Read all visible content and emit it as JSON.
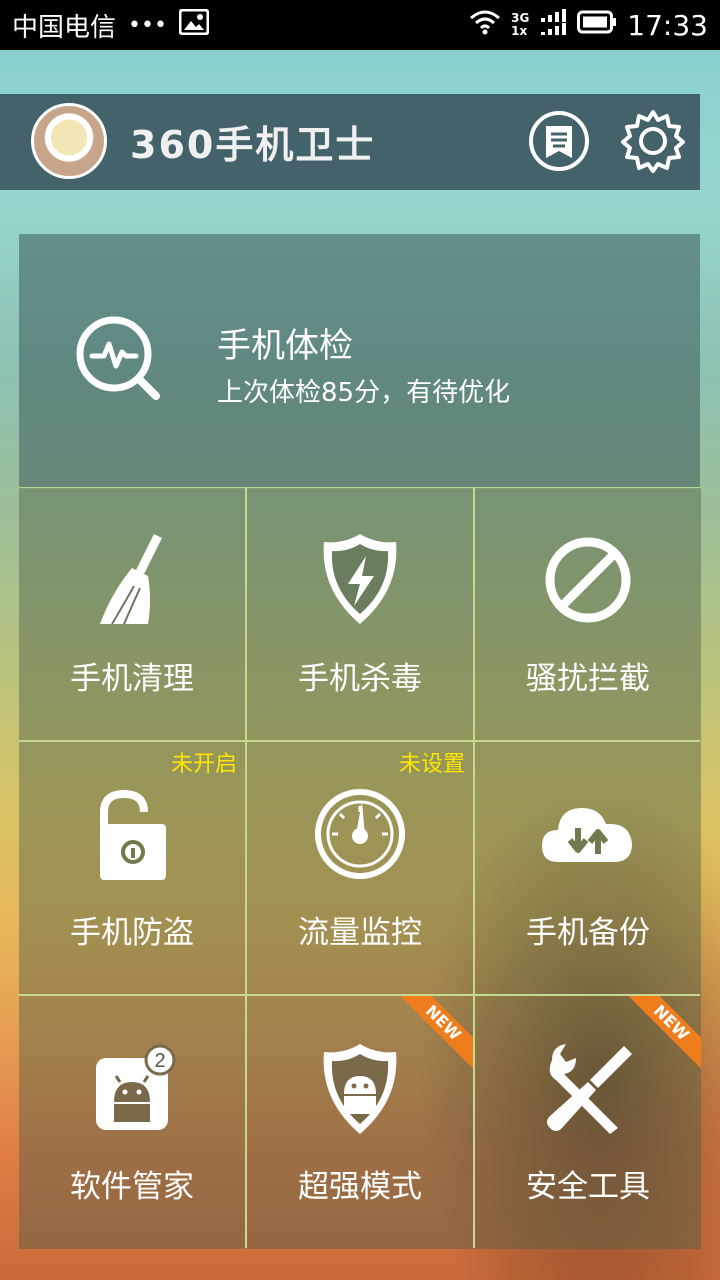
{
  "status_bar": {
    "carrier": "中国电信",
    "dots": "•••",
    "net_top": "3G",
    "net_bottom": "1x",
    "time": "17:33"
  },
  "header": {
    "title": "360手机卫士",
    "badge_icon": "medal-icon",
    "settings_icon": "gear-icon"
  },
  "checkup": {
    "title": "手机体检",
    "subtitle": "上次体检85分，有待优化"
  },
  "tiles": [
    {
      "label": "手机清理",
      "icon": "broom-icon"
    },
    {
      "label": "手机杀毒",
      "icon": "shield-bolt-icon"
    },
    {
      "label": "骚扰拦截",
      "icon": "block-icon"
    },
    {
      "label": "手机防盗",
      "icon": "unlock-icon",
      "badge": "未开启"
    },
    {
      "label": "流量监控",
      "icon": "gauge-icon",
      "badge": "未设置"
    },
    {
      "label": "手机备份",
      "icon": "cloud-sync-icon"
    },
    {
      "label": "软件管家",
      "icon": "android-box-icon",
      "count": "2"
    },
    {
      "label": "超强模式",
      "icon": "android-shield-icon",
      "ribbon": "NEW"
    },
    {
      "label": "安全工具",
      "icon": "tools-icon",
      "ribbon": "NEW"
    }
  ],
  "colors": {
    "header_bg": "#43626a",
    "badge_text": "#ffe600",
    "ribbon": "#f07d1c",
    "grid_line": "#c6d98f"
  }
}
